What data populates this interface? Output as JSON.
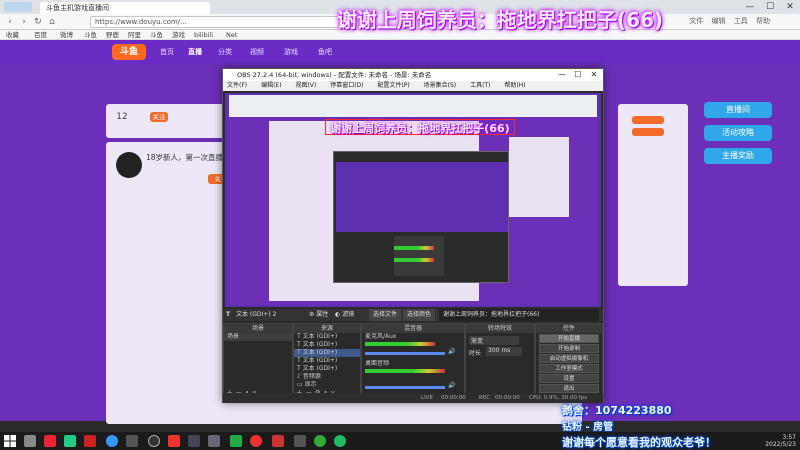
{
  "browser": {
    "tab_title": "斗鱼主机游戏直播间",
    "address": "https://www.douyu.com/...",
    "bookmarks": [
      "收藏",
      "百度",
      "微博",
      "斗鱼",
      "野鹿",
      "阿里",
      "斗鱼",
      "游戏",
      "bilibili",
      "Net"
    ],
    "right_buttons": [
      "文件",
      "编辑",
      "工具",
      "帮助"
    ]
  },
  "site": {
    "logo": "斗鱼",
    "nav": [
      "首页",
      "直播",
      "分类",
      "视频",
      "游戏",
      "鱼吧"
    ],
    "panel_count": "12",
    "panel_left_text": "18岁新人，第一次直播",
    "follow_label": "关注",
    "side_buttons": [
      "直播间",
      "活动攻略",
      "主播奖励"
    ]
  },
  "overlay": {
    "title": "谢谢上周饲养员：拖地界扛把子(66)",
    "inner_title": "谢谢上周饲养员：拖地界扛把子(66)",
    "qq_line": "鹅舍：1074223880",
    "fan_line": "钻粉 - 房管",
    "thanks_line": "谢谢每个愿意看我的观众老爷！"
  },
  "obs": {
    "title": "OBS 27.2.4 (64-bit, windows) - 配置文件: 未命名 - 场景: 未命名",
    "menu": [
      "文件(F)",
      "编辑(E)",
      "视图(V)",
      "停靠窗口(D)",
      "配置文件(P)",
      "场景集合(S)",
      "工具(T)",
      "帮助(H)"
    ],
    "toolbar": {
      "source_label": "文本 (GDI+) 2",
      "properties": "属性",
      "filters": "滤镜",
      "select_file": "选择文件",
      "select_color": "选择颜色",
      "text_preview": "谢谢上周饲养员：拖地界扛把子(66)"
    },
    "docks": {
      "scenes": {
        "header": "场景",
        "items": [
          "场景"
        ]
      },
      "sources": {
        "header": "来源",
        "items": [
          "文本 (GDI+)",
          "文本 (GDI+)",
          "文本 (GDI+)",
          "文本 (GDI+)",
          "文本 (GDI+)",
          "音频源",
          "显示"
        ]
      },
      "mixer": {
        "header": "混音器",
        "tracks": [
          {
            "name": "麦克风/Aux"
          },
          {
            "name": "桌面音频"
          }
        ]
      },
      "transitions": {
        "header": "转场特效",
        "type": "渐变",
        "duration_label": "时长",
        "duration": "300 ms"
      },
      "controls": {
        "header": "控件",
        "buttons": [
          "开始直播",
          "开始录制",
          "启动虚拟摄像机",
          "工作室模式",
          "设置",
          "退出"
        ]
      }
    },
    "status": {
      "live": "LIVE",
      "live_time": "00:00:00",
      "rec": "REC",
      "rec_time": "00:00:00",
      "cpu": "CPU: 0.9%, 30.00 fps"
    }
  },
  "taskbar": {
    "time": "3:57",
    "date": "2022/5/23"
  }
}
